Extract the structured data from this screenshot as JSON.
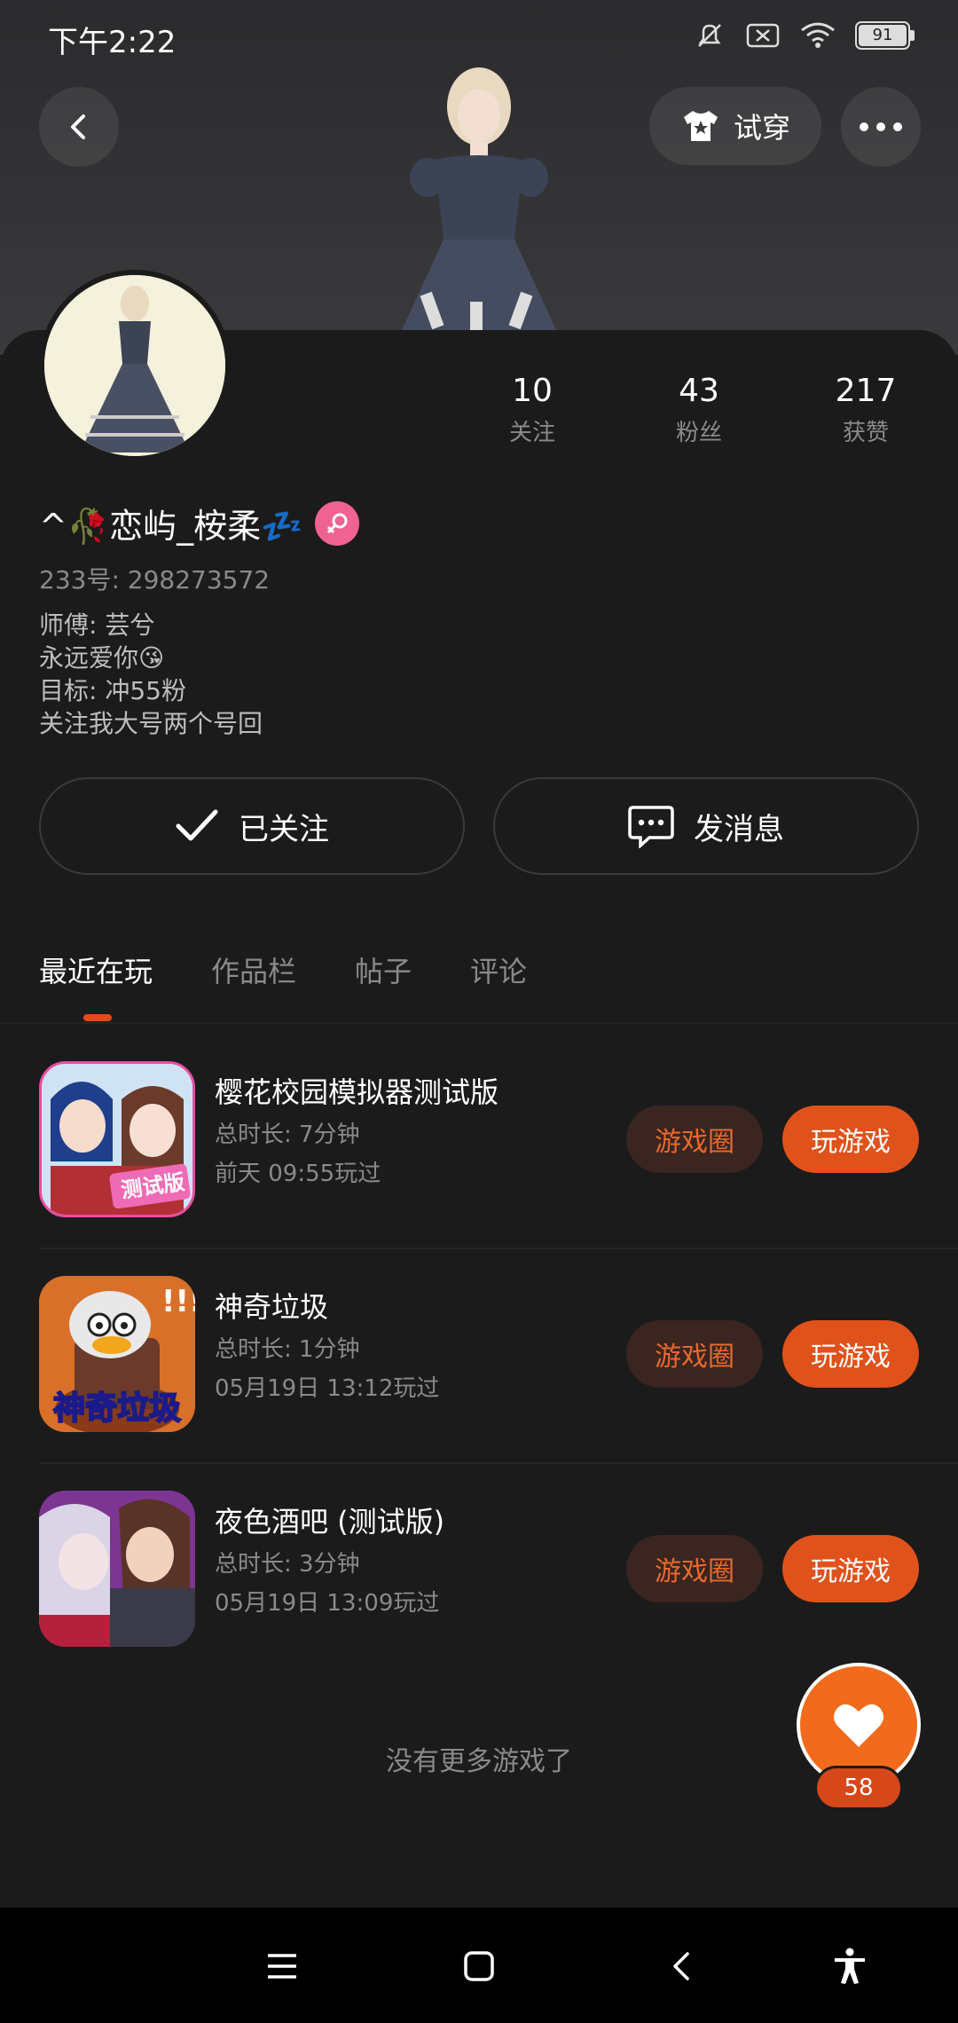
{
  "status_bar": {
    "time": "下午2:22",
    "battery": "91"
  },
  "header": {
    "tryon_label": "试穿"
  },
  "stats": [
    {
      "value": "10",
      "label": "关注"
    },
    {
      "value": "43",
      "label": "粉丝"
    },
    {
      "value": "217",
      "label": "获赞"
    }
  ],
  "profile": {
    "nickname": "^🥀恋屿_桉柔💤",
    "uid": "233号: 298273572",
    "bio": [
      "师傅: 芸兮",
      "永远爱你😘",
      "目标: 冲55粉",
      "关注我大号两个号回"
    ]
  },
  "actions": {
    "followed_label": "已关注",
    "message_label": "发消息"
  },
  "tabs": [
    "最近在玩",
    "作品栏",
    "帖子",
    "评论"
  ],
  "games": [
    {
      "name": "樱花校园模拟器测试版",
      "duration": "总时长: 7分钟",
      "last_played": "前天 09:55玩过",
      "circle_label": "游戏圈",
      "play_label": "玩游戏",
      "icon_text": "测试版",
      "icon_color": "#c8e0f5"
    },
    {
      "name": "神奇垃圾",
      "duration": "总时长: 1分钟",
      "last_played": "05月19日 13:12玩过",
      "circle_label": "游戏圈",
      "play_label": "玩游戏",
      "icon_text": "神奇垃圾",
      "icon_color": "#e0742a"
    },
    {
      "name": "夜色酒吧 (测试版)",
      "duration": "总时长: 3分钟",
      "last_played": "05月19日 13:09玩过",
      "circle_label": "游戏圈",
      "play_label": "玩游戏",
      "icon_text": "",
      "icon_color": "#8a3a9a"
    }
  ],
  "footer": {
    "no_more": "没有更多游戏了"
  },
  "like": {
    "count": "58"
  },
  "colors": {
    "accent": "#e0521b",
    "background": "#1b1b1b"
  }
}
